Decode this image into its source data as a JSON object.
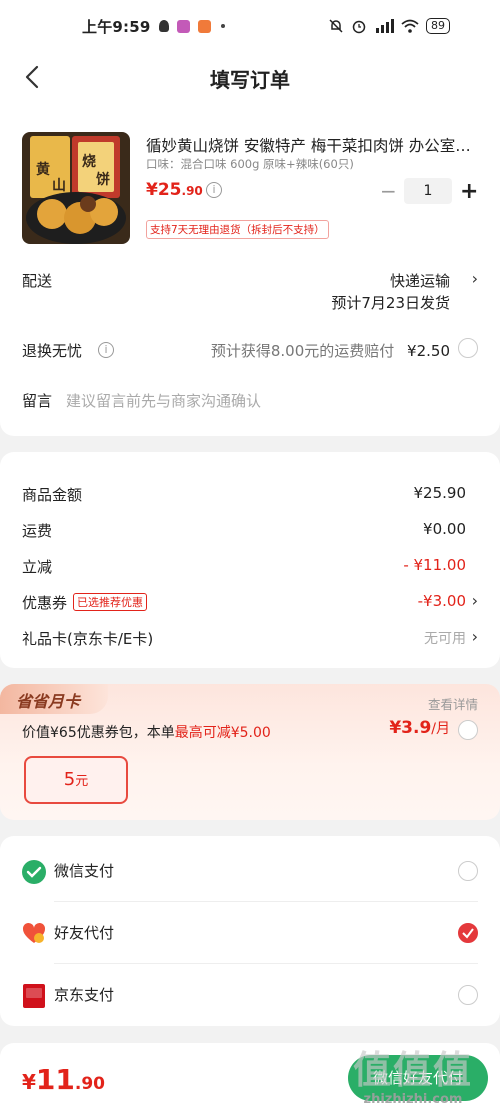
{
  "status_bar": {
    "time": "上午9:59",
    "battery": "89"
  },
  "nav": {
    "title": "填写订单"
  },
  "product": {
    "title": "循妙黄山烧饼  安徽特产 梅干菜扣肉饼 办公室零食",
    "spec": "口味：混合口味 600g 原味+辣味(60只)",
    "price_symbol": "¥",
    "price_int": "25",
    "price_dec": ".90",
    "quantity": "1",
    "return_tag": "支持7天无理由退货（拆封后不支持）",
    "image_text": "黄山烧饼"
  },
  "delivery": {
    "label": "配送",
    "method": "快递运输",
    "date": "预计7月23日发货"
  },
  "return_insurance": {
    "label": "退换无忧",
    "desc": "预计获得8.00元的运费赔付",
    "price": "¥2.50"
  },
  "remark": {
    "label": "留言",
    "placeholder": "建议留言前先与商家沟通确认"
  },
  "summary": {
    "goods_label": "商品金额",
    "goods_value": "¥25.90",
    "shipping_label": "运费",
    "shipping_value": "¥0.00",
    "discount_label": "立减",
    "discount_value": "- ¥11.00",
    "coupon_label": "优惠券",
    "coupon_tag": "已选推荐优惠",
    "coupon_value": "-¥3.00",
    "giftcard_label": "礼品卡(京东卡/E卡)",
    "giftcard_value": "无可用"
  },
  "monthly_card": {
    "badge": "省省月卡",
    "detail_link": "查看详情",
    "desc_prefix": "价值¥65优惠券包，本单",
    "desc_highlight": "最高可减¥5.00",
    "price": "¥3.9",
    "price_unit": "/月",
    "coupon_amount": "5",
    "coupon_unit": "元"
  },
  "payment": {
    "methods": [
      {
        "label": "微信支付",
        "checked": false
      },
      {
        "label": "好友代付",
        "checked": true
      },
      {
        "label": "京东支付",
        "checked": false
      }
    ],
    "jd_icon_text": "东付"
  },
  "footer": {
    "yen": "¥",
    "total_int": "11",
    "total_dec": ".90",
    "submit_label": "微信好友代付"
  },
  "watermark": {
    "big": "值值值",
    "small": "zhizhizhi.com"
  },
  "colors": {
    "accent": "#e2231a",
    "wechat_green": "#2aae67",
    "page_bg": "#f2f2f2"
  }
}
